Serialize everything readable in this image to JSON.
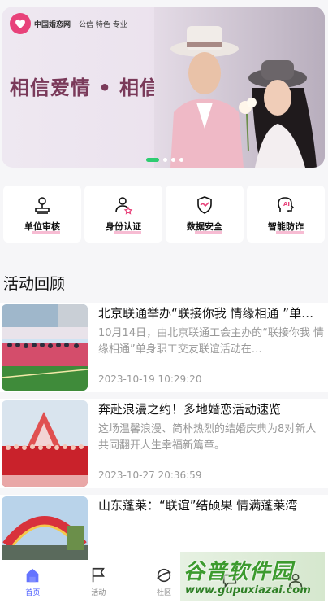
{
  "banner": {
    "logo_text": "中国婚恋网",
    "logo_tagline": "公信 特色 专业",
    "slogan": "相信爱情 • 相信我们",
    "dots_total": 4,
    "dots_active_index": 0
  },
  "features": [
    {
      "label": "单位审核",
      "icon": "building-icon"
    },
    {
      "label": "身份认证",
      "icon": "user-verify-icon"
    },
    {
      "label": "数据安全",
      "icon": "shield-icon"
    },
    {
      "label": "智能防诈",
      "icon": "ai-head-icon"
    }
  ],
  "section": {
    "title": "活动回顾"
  },
  "activities": [
    {
      "title": "北京联通举办“联接你我 情缘相通 ”单身职工交友联谊活动",
      "desc": "10月14日，由北京联通工会主办的“联接你我 情缘相通”单身职工交友联谊活动在…",
      "time": "2023-10-19 10:29:20"
    },
    {
      "title": "奔赴浪漫之约！多地婚恋活动速览",
      "desc": "这场温馨浪漫、简朴热烈的结婚庆典为8对新人共同翻开人生幸福新篇章。",
      "time": "2023-10-27 20:36:59"
    },
    {
      "title": "山东蓬莱：“联谊”结硕果 情满蓬莱湾",
      "desc": "",
      "time": ""
    }
  ],
  "tabbar": [
    {
      "label": "首页",
      "icon": "home-icon",
      "active": true
    },
    {
      "label": "活动",
      "icon": "flag-icon",
      "active": false
    },
    {
      "label": "社区",
      "icon": "planet-icon",
      "active": false
    },
    {
      "label": "",
      "icon": "chat-icon",
      "active": false
    },
    {
      "label": "",
      "icon": "user-icon",
      "active": false
    }
  ],
  "watermark": {
    "main": "谷普软件园",
    "url": "www.gupuxiazai.com"
  },
  "colors": {
    "brand_pink": "#e8427a",
    "slogan": "#7a3a5a",
    "active_dot": "#2ecc71",
    "tab_active": "#4a5cff"
  }
}
